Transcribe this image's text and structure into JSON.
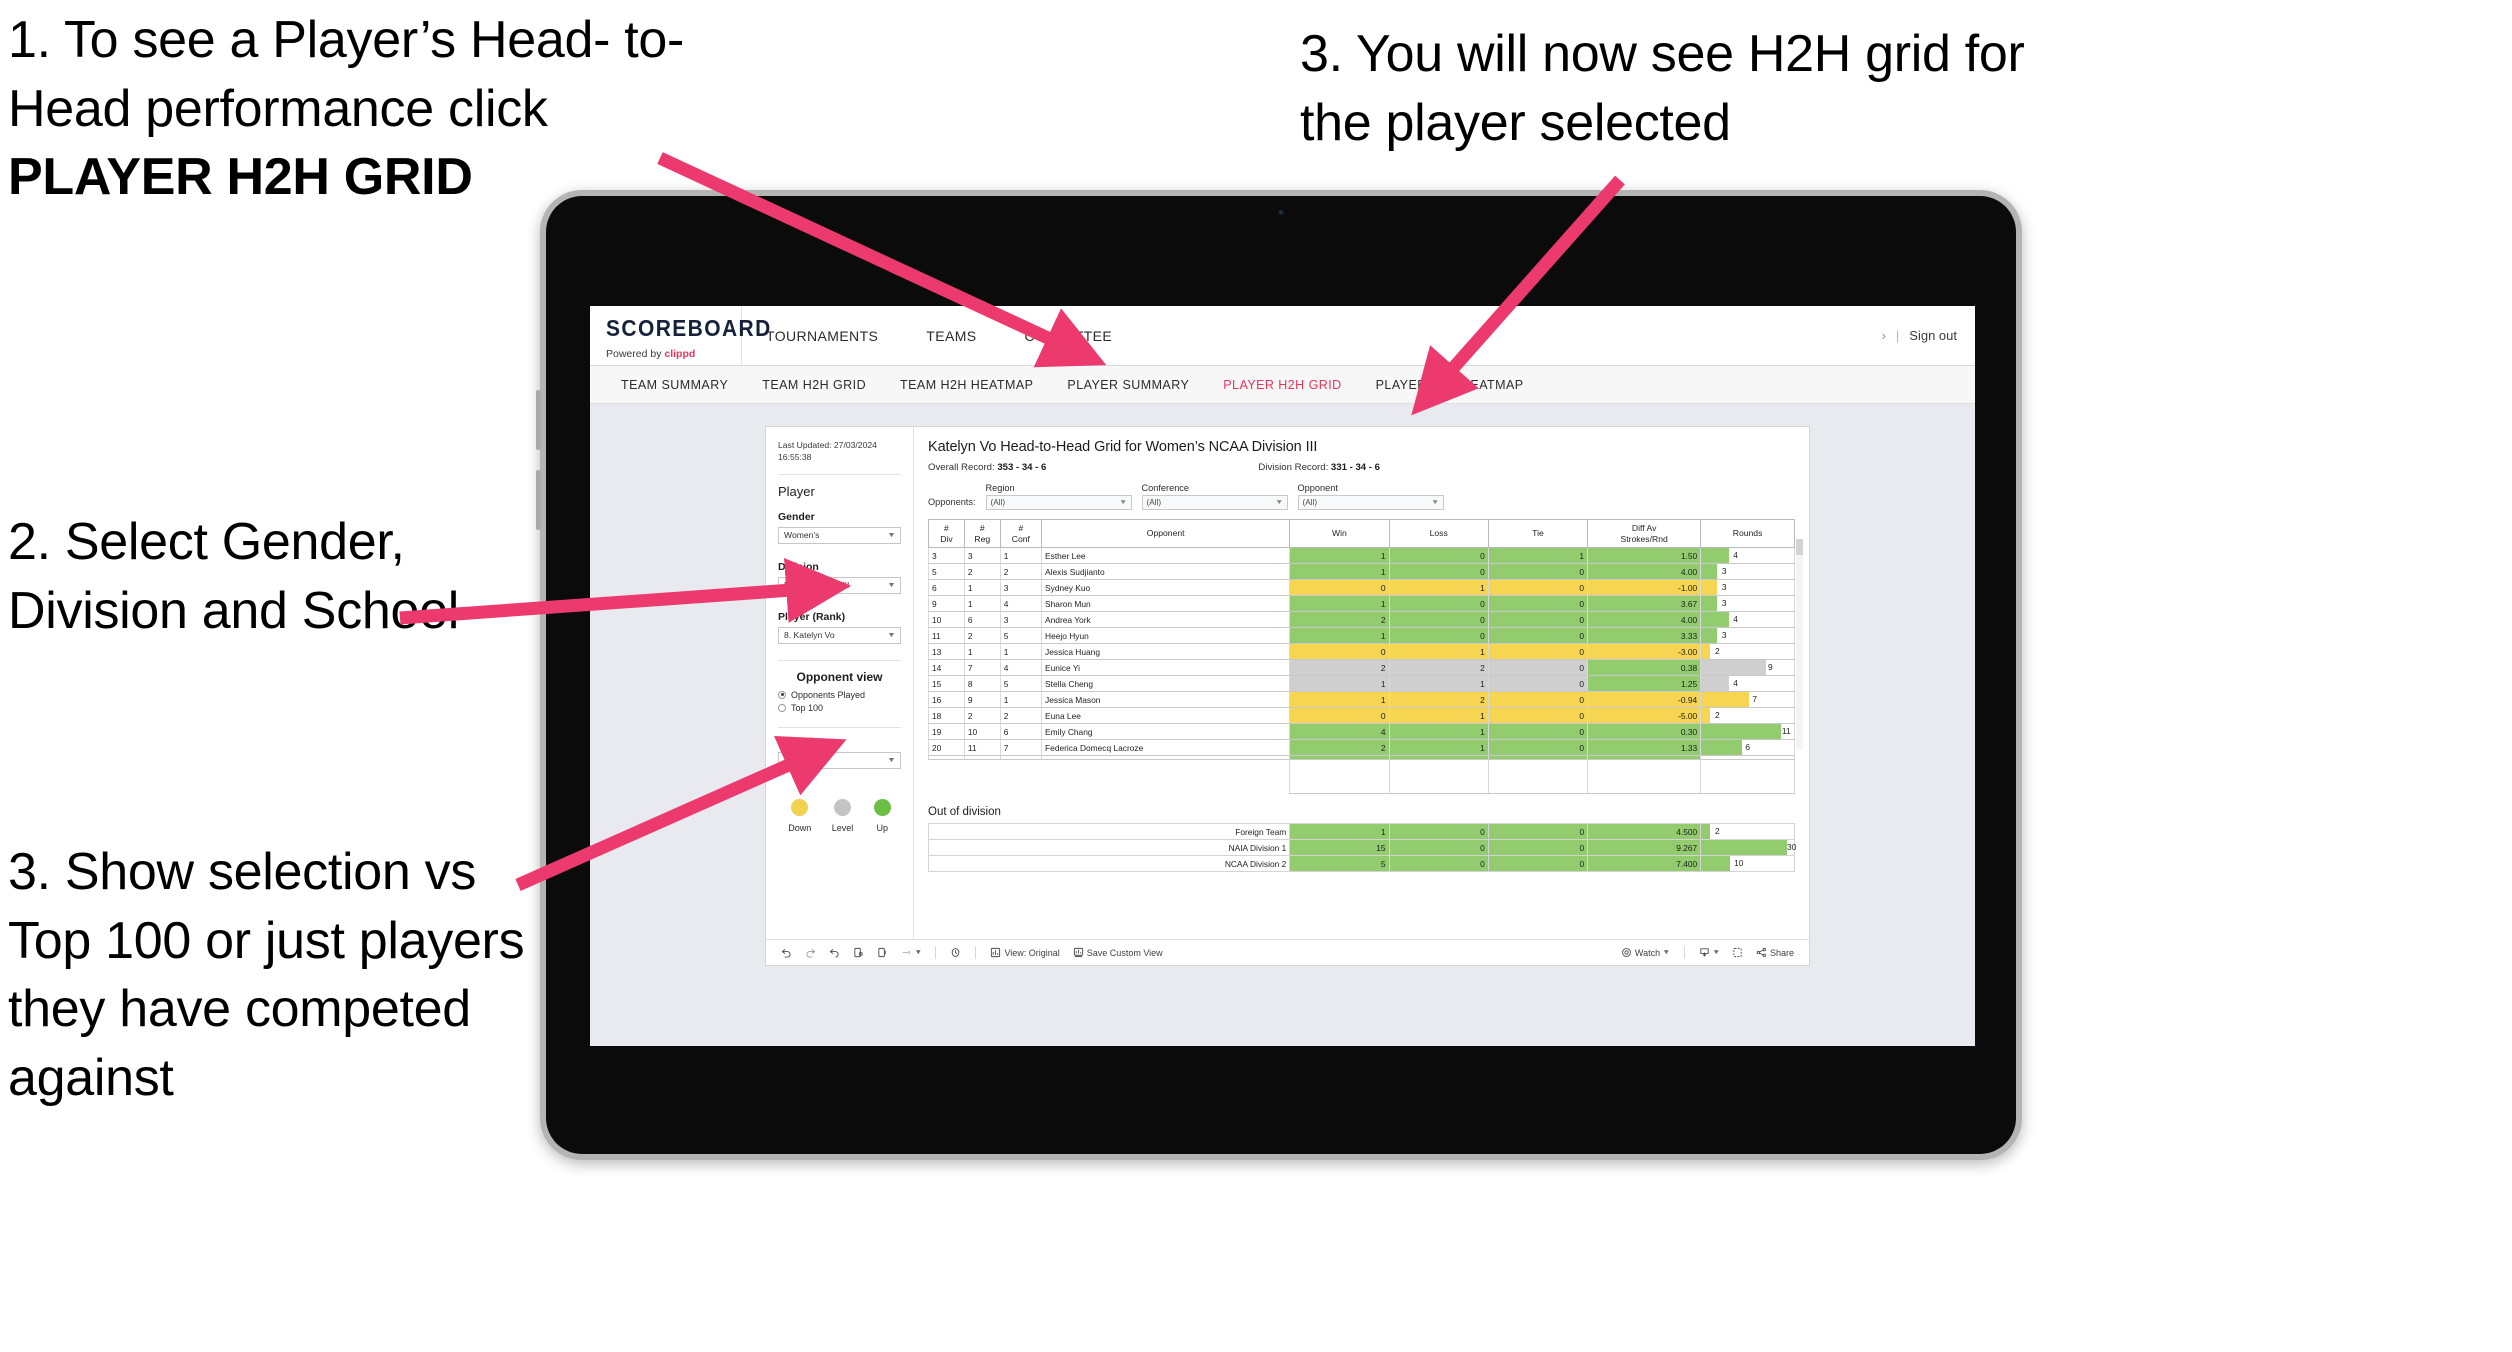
{
  "annotations": [
    {
      "id": "ann-1",
      "line1": "1. To see a Player’s Head-",
      "line2": "to-Head performance click",
      "bold": "PLAYER H2H GRID"
    },
    {
      "id": "ann-2",
      "text": "2. Select Gender, Division and School"
    },
    {
      "id": "ann-3",
      "text": "3. Show selection vs Top 100 or just players they have competed against"
    },
    {
      "id": "ann-4",
      "text": "3. You will now see H2H grid for the player selected"
    }
  ],
  "colors": {
    "accent": "#e8355a",
    "green": "#92cc6e",
    "yellow": "#f5d552",
    "gray": "#cfcfcf",
    "brand_navy": "#16213c"
  },
  "app": {
    "brand": {
      "name": "SCOREBOARD",
      "powered_prefix": "Powered by ",
      "powered_by": "clippd"
    },
    "top_nav": [
      {
        "label": "TOURNAMENTS"
      },
      {
        "label": "TEAMS"
      },
      {
        "label": "COMMITTEE"
      }
    ],
    "top_right": {
      "chevron": "›",
      "divider": "|",
      "sign_out": "Sign out"
    },
    "tabs": [
      {
        "label": "TEAM SUMMARY",
        "active": false
      },
      {
        "label": "TEAM H2H GRID",
        "active": false
      },
      {
        "label": "TEAM H2H HEATMAP",
        "active": false
      },
      {
        "label": "PLAYER SUMMARY",
        "active": false
      },
      {
        "label": "PLAYER H2H GRID",
        "active": true
      },
      {
        "label": "PLAYER H2H HEATMAP",
        "active": false
      }
    ]
  },
  "sidebar": {
    "last_updated": "Last Updated: 27/03/2024 16:55:38",
    "player_heading": "Player",
    "gender": {
      "label": "Gender",
      "value": "Women's"
    },
    "division": {
      "label": "Division",
      "value": "NCAA Division III"
    },
    "player_rank": {
      "label": "Player (Rank)",
      "value": "8. Katelyn Vo"
    },
    "opponent_view": {
      "heading": "Opponent view",
      "options": [
        {
          "label": "Opponents Played",
          "checked": true
        },
        {
          "label": "Top 100",
          "checked": false
        }
      ]
    },
    "colour_by": {
      "label": "Colour by",
      "value": "Win/loss"
    },
    "legend": [
      {
        "caption": "Down",
        "color": "#f2d14e"
      },
      {
        "caption": "Level",
        "color": "#c4c4c4"
      },
      {
        "caption": "Up",
        "color": "#6cbe45"
      }
    ]
  },
  "main": {
    "title": "Katelyn Vo Head-to-Head Grid for Women’s NCAA Division III",
    "overall_record_label": "Overall Record: ",
    "overall_record": "353 -  34 - 6",
    "division_record_label": "Division Record: ",
    "division_record": "331 -  34 - 6",
    "opponents_label": "Opponents:",
    "filters": [
      {
        "title": "Region",
        "value": "(All)"
      },
      {
        "title": "Conference",
        "value": "(All)"
      },
      {
        "title": "Opponent",
        "value": "(All)"
      }
    ],
    "columns": [
      {
        "line1": "#",
        "line2": "Div"
      },
      {
        "line1": "#",
        "line2": "Reg"
      },
      {
        "line1": "#",
        "line2": "Conf"
      },
      {
        "line1": "",
        "line2": "Opponent"
      },
      {
        "line1": "",
        "line2": "Win"
      },
      {
        "line1": "",
        "line2": "Loss"
      },
      {
        "line1": "",
        "line2": "Tie"
      },
      {
        "line1": "Diff Av",
        "line2": "Strokes/Rnd"
      },
      {
        "line1": "",
        "line2": "Rounds"
      }
    ],
    "rows": [
      {
        "div": "3",
        "reg": "3",
        "conf": "1",
        "opponent": "Esther Lee",
        "win": "1",
        "loss": "0",
        "tie": "1",
        "diff": "1.50",
        "rounds": "4",
        "color": "green",
        "bar_pct": 30
      },
      {
        "div": "5",
        "reg": "2",
        "conf": "2",
        "opponent": "Alexis Sudjianto",
        "win": "1",
        "loss": "0",
        "tie": "0",
        "diff": "4.00",
        "rounds": "3",
        "color": "green",
        "bar_pct": 17
      },
      {
        "div": "6",
        "reg": "1",
        "conf": "3",
        "opponent": "Sydney Kuo",
        "win": "0",
        "loss": "1",
        "tie": "0",
        "diff": "-1.00",
        "rounds": "3",
        "color": "yellow",
        "bar_pct": 17
      },
      {
        "div": "9",
        "reg": "1",
        "conf": "4",
        "opponent": "Sharon Mun",
        "win": "1",
        "loss": "0",
        "tie": "0",
        "diff": "3.67",
        "rounds": "3",
        "color": "green",
        "bar_pct": 17
      },
      {
        "div": "10",
        "reg": "6",
        "conf": "3",
        "opponent": "Andrea York",
        "win": "2",
        "loss": "0",
        "tie": "0",
        "diff": "4.00",
        "rounds": "4",
        "color": "green",
        "bar_pct": 30
      },
      {
        "div": "11",
        "reg": "2",
        "conf": "5",
        "opponent": "Heejo Hyun",
        "win": "1",
        "loss": "0",
        "tie": "0",
        "diff": "3.33",
        "rounds": "3",
        "color": "green",
        "bar_pct": 17
      },
      {
        "div": "13",
        "reg": "1",
        "conf": "1",
        "opponent": "Jessica Huang",
        "win": "0",
        "loss": "1",
        "tie": "0",
        "diff": "-3.00",
        "rounds": "2",
        "color": "yellow",
        "bar_pct": 9
      },
      {
        "div": "14",
        "reg": "7",
        "conf": "4",
        "opponent": "Eunice Yi",
        "win": "2",
        "loss": "2",
        "tie": "0",
        "diff": "0.38",
        "rounds": "9",
        "color": "gray",
        "bar_pct": 70,
        "diff_color": "green"
      },
      {
        "div": "15",
        "reg": "8",
        "conf": "5",
        "opponent": "Stella Cheng",
        "win": "1",
        "loss": "1",
        "tie": "0",
        "diff": "1.25",
        "rounds": "4",
        "color": "gray",
        "bar_pct": 30,
        "diff_color": "green"
      },
      {
        "div": "16",
        "reg": "9",
        "conf": "1",
        "opponent": "Jessica Mason",
        "win": "1",
        "loss": "2",
        "tie": "0",
        "diff": "-0.94",
        "rounds": "7",
        "color": "yellow",
        "bar_pct": 52
      },
      {
        "div": "18",
        "reg": "2",
        "conf": "2",
        "opponent": "Euna Lee",
        "win": "0",
        "loss": "1",
        "tie": "0",
        "diff": "-5.00",
        "rounds": "2",
        "color": "yellow",
        "bar_pct": 9
      },
      {
        "div": "19",
        "reg": "10",
        "conf": "6",
        "opponent": "Emily Chang",
        "win": "4",
        "loss": "1",
        "tie": "0",
        "diff": "0.30",
        "rounds": "11",
        "color": "green",
        "bar_pct": 86
      },
      {
        "div": "20",
        "reg": "11",
        "conf": "7",
        "opponent": "Federica Domecq Lacroze",
        "win": "2",
        "loss": "1",
        "tie": "0",
        "diff": "1.33",
        "rounds": "6",
        "color": "green",
        "bar_pct": 44
      }
    ],
    "out_of_division": {
      "title": "Out of division",
      "rows": [
        {
          "name": "Foreign Team",
          "win": "1",
          "loss": "0",
          "tie": "0",
          "diff": "4.500",
          "rounds": "2",
          "color": "green",
          "bar_pct": 9
        },
        {
          "name": "NAIA Division 1",
          "win": "15",
          "loss": "0",
          "tie": "0",
          "diff": "9.267",
          "rounds": "30",
          "color": "green",
          "bar_pct": 92
        },
        {
          "name": "NCAA Division 2",
          "win": "5",
          "loss": "0",
          "tie": "0",
          "diff": "7.400",
          "rounds": "10",
          "color": "green",
          "bar_pct": 31
        }
      ]
    }
  },
  "toolbar": {
    "view_label": "View: Original",
    "save_label": "Save Custom View",
    "watch_label": "Watch",
    "share_label": "Share"
  }
}
